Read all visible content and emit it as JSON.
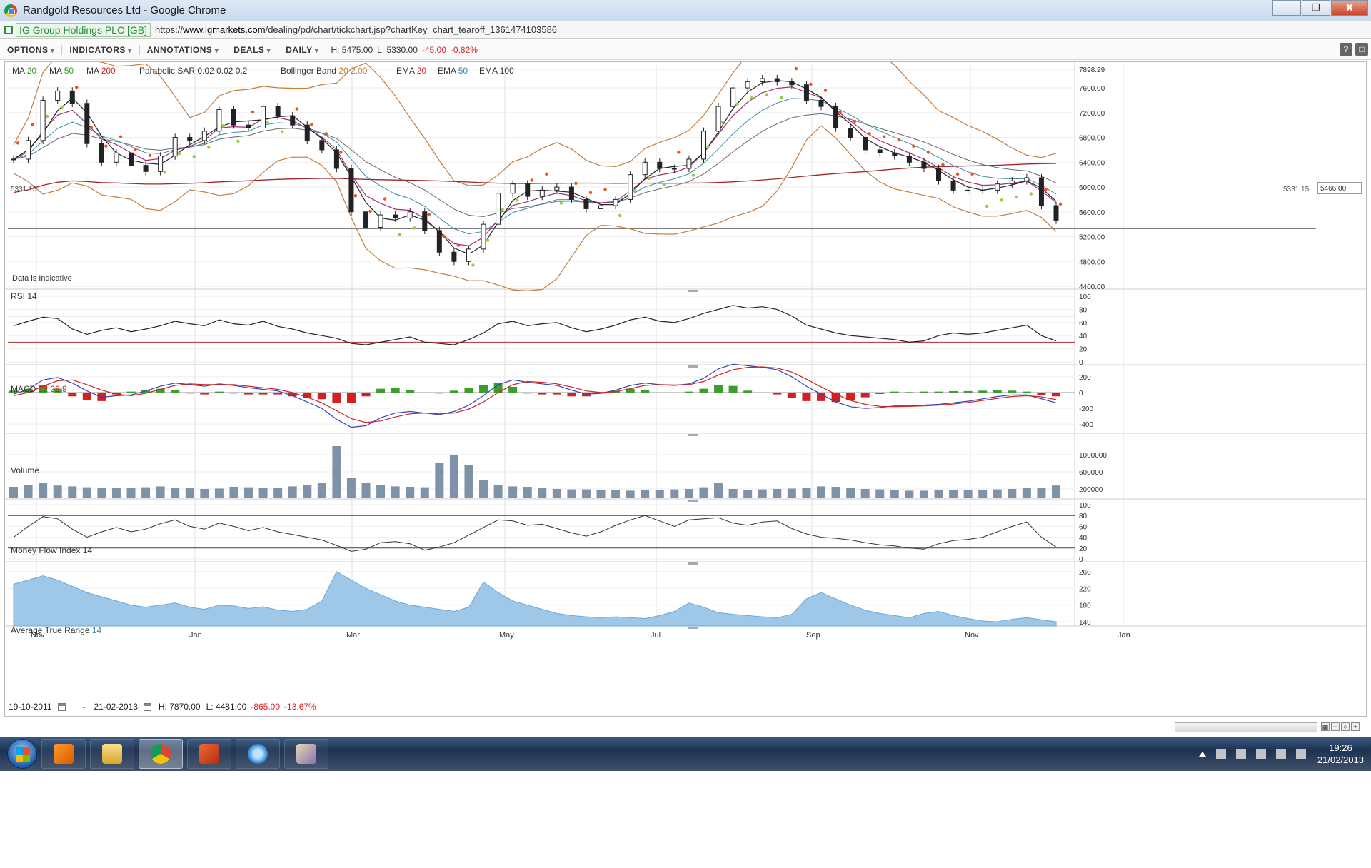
{
  "window": {
    "title": "Randgold Resources Ltd - Google Chrome",
    "controls": {
      "minimize": "—",
      "maximize": "❐",
      "close": "✖"
    }
  },
  "address": {
    "site_identity": "IG Group Holdings PLC [GB]",
    "url_scheme": "https://",
    "url_host": "www.igmarkets.com",
    "url_path": "/dealing/pd/chart/tickchart.jsp?chartKey=chart_tearoff_1361474103586"
  },
  "toolbar": {
    "menus": [
      "OPTIONS",
      "INDICATORS",
      "ANNOTATIONS",
      "DEALS",
      "DAILY"
    ],
    "high": "H: 5475.00",
    "low": "L: 5330.00",
    "change": "-45.00",
    "change_pct": "-0.82%",
    "help_label": "?",
    "popout_label": "□"
  },
  "colors": {
    "up": "#3a9e2a",
    "down": "#d42020",
    "sar_up": "#8fd13b",
    "sar_down": "#f04e23",
    "bollinger": "#c47d3c",
    "ma20": "#222222",
    "ma50": "#a0307a",
    "ma200": "#a02828",
    "ema20": "#4060a0",
    "ema50": "#3a8aa0",
    "ema100": "#6a6a6a",
    "atr_fill": "#9fc8e8",
    "macd_line": "#3344bb",
    "signal_line": "#cc2222"
  },
  "legend": {
    "items": [
      {
        "label": "MA",
        "param": "20"
      },
      {
        "label": "MA",
        "param": "50"
      },
      {
        "label": "MA",
        "param": "200"
      },
      {
        "label": "Parabolic SAR",
        "param": "0.02  0.02  0.2"
      },
      {
        "label": "Bollinger Band",
        "param": "20  2.00"
      },
      {
        "label": "EMA",
        "param": "20"
      },
      {
        "label": "EMA",
        "param": "50"
      },
      {
        "label": "EMA",
        "param": "100"
      }
    ],
    "data_note": "Data is Indicative",
    "ref_price": "5331.15",
    "last_price": "5466.00"
  },
  "chart_data": {
    "type": "line",
    "x": [
      "Nov",
      "Jan",
      "Mar",
      "May",
      "Jul",
      "Sep",
      "Nov",
      "Jan"
    ],
    "price": {
      "ticks": [
        "7898.29",
        "7600.00",
        "7200.00",
        "6800.00",
        "6400.00",
        "6000.00",
        "5600.00",
        "5200.00",
        "4800.00",
        "4400.00"
      ],
      "ylim": [
        4400,
        7900
      ],
      "series": {
        "values": [
          6450,
          6750,
          7400,
          7550,
          7350,
          6700,
          6400,
          6550,
          6350,
          6250,
          6500,
          6800,
          6750,
          6900,
          7250,
          7000,
          6950,
          7300,
          7150,
          7000,
          6750,
          6600,
          6300,
          5600,
          5350,
          5550,
          5500,
          5600,
          5300,
          4950,
          4800,
          5000,
          5400,
          5900,
          6050,
          5850,
          5950,
          6000,
          5800,
          5650,
          5700,
          5800,
          6200,
          6400,
          6300,
          6300,
          6450,
          6900,
          7300,
          7600,
          7700,
          7750,
          7700,
          7650,
          7400,
          7300,
          6950,
          6800,
          6600,
          6550,
          6500,
          6400,
          6300,
          6100,
          5950,
          5950,
          5950,
          6050,
          6100,
          6150,
          5700,
          5466
        ]
      }
    },
    "rsi": {
      "title": "RSI",
      "param": "14",
      "ticks": [
        "100",
        "80",
        "60",
        "40",
        "20",
        "0"
      ],
      "ylim": [
        0,
        100
      ],
      "upper": 70,
      "lower": 30,
      "values": [
        55,
        62,
        68,
        66,
        50,
        42,
        48,
        52,
        46,
        50,
        55,
        62,
        58,
        55,
        64,
        58,
        56,
        62,
        54,
        50,
        44,
        40,
        36,
        28,
        26,
        30,
        34,
        38,
        30,
        28,
        26,
        34,
        44,
        58,
        62,
        55,
        58,
        60,
        52,
        46,
        50,
        56,
        64,
        68,
        62,
        60,
        66,
        74,
        80,
        86,
        82,
        84,
        80,
        70,
        56,
        50,
        44,
        40,
        38,
        36,
        34,
        30,
        32,
        40,
        44,
        42,
        44,
        48,
        52,
        56,
        40,
        32
      ]
    },
    "macd": {
      "title": "MACD",
      "params": "12  26  9",
      "ticks": [
        "200",
        "0",
        "-200",
        "-400"
      ],
      "ylim": [
        -480,
        280
      ],
      "macd": [
        -20,
        40,
        160,
        190,
        120,
        20,
        -60,
        -40,
        -30,
        20,
        80,
        120,
        100,
        80,
        110,
        90,
        60,
        40,
        20,
        -40,
        -120,
        -200,
        -340,
        -440,
        -420,
        -320,
        -260,
        -240,
        -260,
        -280,
        -240,
        -160,
        -40,
        100,
        160,
        130,
        110,
        90,
        30,
        -20,
        -10,
        30,
        90,
        120,
        100,
        90,
        110,
        180,
        300,
        360,
        340,
        320,
        290,
        200,
        80,
        -20,
        -120,
        -180,
        -200,
        -190,
        -170,
        -170,
        -160,
        -150,
        -130,
        -110,
        -80,
        -50,
        -30,
        -30,
        -80,
        -130
      ],
      "signal": [
        -40,
        0,
        80,
        150,
        160,
        100,
        30,
        -20,
        -40,
        -10,
        40,
        90,
        110,
        100,
        100,
        100,
        80,
        60,
        40,
        0,
        -60,
        -130,
        -230,
        -330,
        -380,
        -360,
        -310,
        -270,
        -260,
        -270,
        -260,
        -210,
        -120,
        0,
        100,
        140,
        130,
        110,
        70,
        20,
        0,
        10,
        50,
        90,
        100,
        95,
        100,
        140,
        220,
        290,
        320,
        325,
        310,
        260,
        170,
        70,
        -20,
        -100,
        -150,
        -175,
        -180,
        -175,
        -170,
        -160,
        -145,
        -125,
        -100,
        -75,
        -50,
        -40,
        -55,
        -90
      ]
    },
    "volume": {
      "title": "Volume",
      "ticks": [
        "1000000",
        "600000",
        "200000"
      ],
      "ylim": [
        0,
        1300000
      ],
      "values": [
        250000,
        300000,
        350000,
        280000,
        260000,
        240000,
        230000,
        220000,
        220000,
        240000,
        260000,
        230000,
        220000,
        200000,
        210000,
        250000,
        240000,
        220000,
        230000,
        260000,
        300000,
        350000,
        1200000,
        450000,
        350000,
        300000,
        260000,
        250000,
        240000,
        800000,
        1000000,
        750000,
        400000,
        300000,
        260000,
        250000,
        230000,
        200000,
        190000,
        190000,
        180000,
        170000,
        160000,
        170000,
        180000,
        190000,
        200000,
        240000,
        350000,
        200000,
        180000,
        190000,
        200000,
        210000,
        220000,
        260000,
        250000,
        220000,
        200000,
        190000,
        170000,
        160000,
        160000,
        170000,
        170000,
        180000,
        180000,
        190000,
        200000,
        230000,
        220000,
        280000
      ]
    },
    "mfi": {
      "title": "Money Flow Index",
      "param": "14",
      "ticks": [
        "100",
        "80",
        "60",
        "40",
        "20",
        "0"
      ],
      "ylim": [
        0,
        100
      ],
      "upper": 80,
      "lower": 20,
      "values": [
        40,
        60,
        78,
        74,
        55,
        40,
        50,
        58,
        50,
        55,
        65,
        72,
        60,
        55,
        66,
        60,
        52,
        58,
        50,
        45,
        40,
        35,
        25,
        14,
        18,
        30,
        32,
        28,
        16,
        22,
        30,
        44,
        58,
        72,
        70,
        62,
        64,
        56,
        48,
        42,
        50,
        62,
        72,
        80,
        70,
        60,
        72,
        74,
        76,
        66,
        62,
        68,
        70,
        56,
        46,
        40,
        38,
        35,
        30,
        26,
        24,
        20,
        18,
        28,
        34,
        36,
        40,
        50,
        60,
        68,
        40,
        22
      ]
    },
    "atr": {
      "title": "Average True Range",
      "param": "14",
      "ticks": [
        "260",
        "220",
        "180",
        "140"
      ],
      "ylim": [
        130,
        270
      ],
      "values": [
        230,
        240,
        250,
        240,
        225,
        210,
        200,
        190,
        180,
        175,
        180,
        185,
        175,
        170,
        180,
        178,
        172,
        176,
        168,
        165,
        170,
        190,
        260,
        240,
        220,
        205,
        190,
        180,
        175,
        170,
        165,
        175,
        235,
        210,
        190,
        180,
        170,
        160,
        155,
        152,
        150,
        152,
        150,
        148,
        155,
        165,
        185,
        175,
        162,
        158,
        155,
        152,
        150,
        158,
        195,
        210,
        195,
        180,
        168,
        160,
        155,
        150,
        160,
        165,
        155,
        148,
        142,
        140,
        146,
        150,
        145,
        140
      ]
    }
  },
  "date_range": {
    "from": "19-10-2011",
    "to": "21-02-2013",
    "high": "H: 7870.00",
    "low": "L: 4481.00",
    "change": "-865.00",
    "change_pct": "-13.67%"
  },
  "taskbar": {
    "apps": [
      "media-player-icon",
      "file-explorer-icon",
      "chrome-icon",
      "office-icon",
      "ie-icon",
      "paint-icon"
    ],
    "time": "19:26",
    "date": "21/02/2013"
  }
}
